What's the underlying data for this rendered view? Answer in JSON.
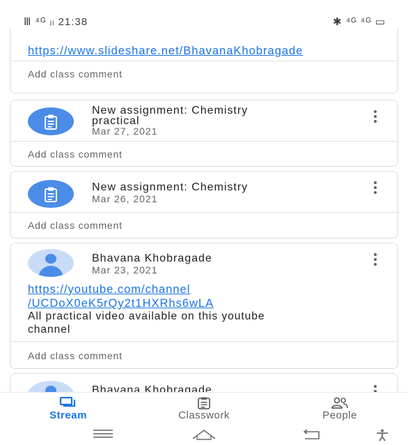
{
  "status_bar": {
    "left": "Ⅲ ⁴ᴳ ᵢₗ 21:38",
    "right": "✱ ⁴ᴳ ⁴ᴳ ▭"
  },
  "cards": [
    {
      "link": "https://www.slideshare.net/BhavanaKhobragade",
      "comment": "Add class comment"
    },
    {
      "type": "assignment",
      "icon": "assignment-icon",
      "title_line1": "New assignment: Chemistry",
      "title_line2": "practical",
      "date": "Mar 27, 2021",
      "comment": "Add class comment"
    },
    {
      "type": "assignment",
      "icon": "assignment-icon",
      "title_line1": "New assignment: Chemistry",
      "date": "Mar 26, 2021",
      "comment": "Add class comment"
    },
    {
      "type": "announcement",
      "icon": "person-avatar-icon",
      "author": "Bhavana Khobragade",
      "date": "Mar 23, 2021",
      "link_line1": "https://youtube.com/channel",
      "link_line2": "/UCDoX0eK5rQy2t1HXRhs6wLA",
      "text_line1": "All practical video available on this youtube",
      "text_line2": "channel",
      "comment": "Add class comment"
    },
    {
      "type": "announcement",
      "icon": "person-avatar-icon",
      "author": "Bhavana Khobragade"
    }
  ],
  "tabs": [
    {
      "label": "Stream",
      "icon": "stream-icon",
      "active": true
    },
    {
      "label": "Classwork",
      "icon": "classwork-icon",
      "active": false
    },
    {
      "label": "People",
      "icon": "people-icon",
      "active": false
    }
  ],
  "colors": {
    "accent": "#1a73e8",
    "icon_blue": "#4a8ce8",
    "avatar_bg": "#c9dcf7"
  }
}
